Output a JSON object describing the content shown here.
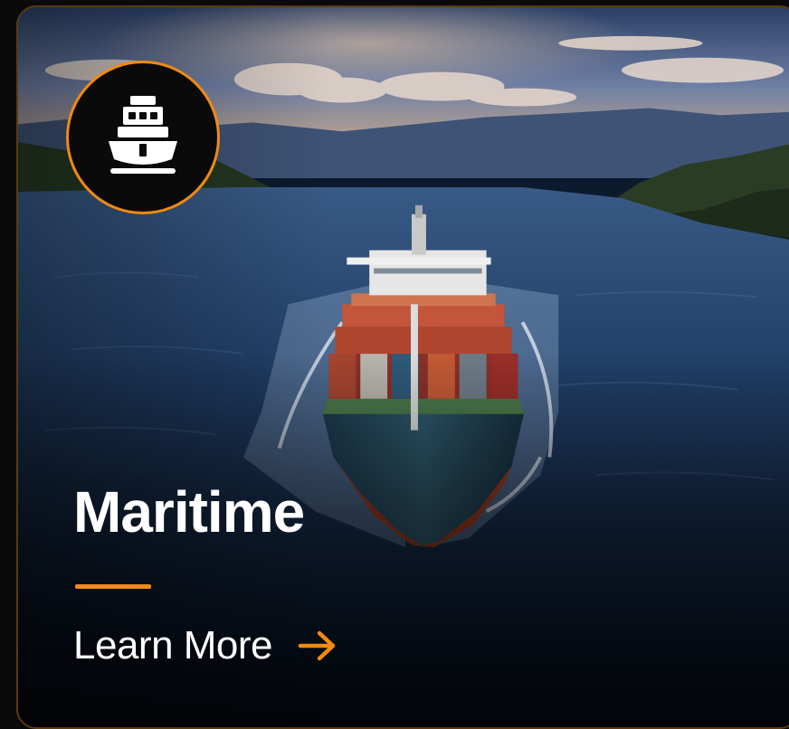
{
  "card": {
    "title": "Maritime",
    "link_label": "Learn More",
    "badge_icon": "ship-icon",
    "link_icon": "arrow-right-icon",
    "colors": {
      "accent": "#f08a12",
      "text": "#ffffff",
      "badge_background": "#0a0a0a"
    }
  }
}
